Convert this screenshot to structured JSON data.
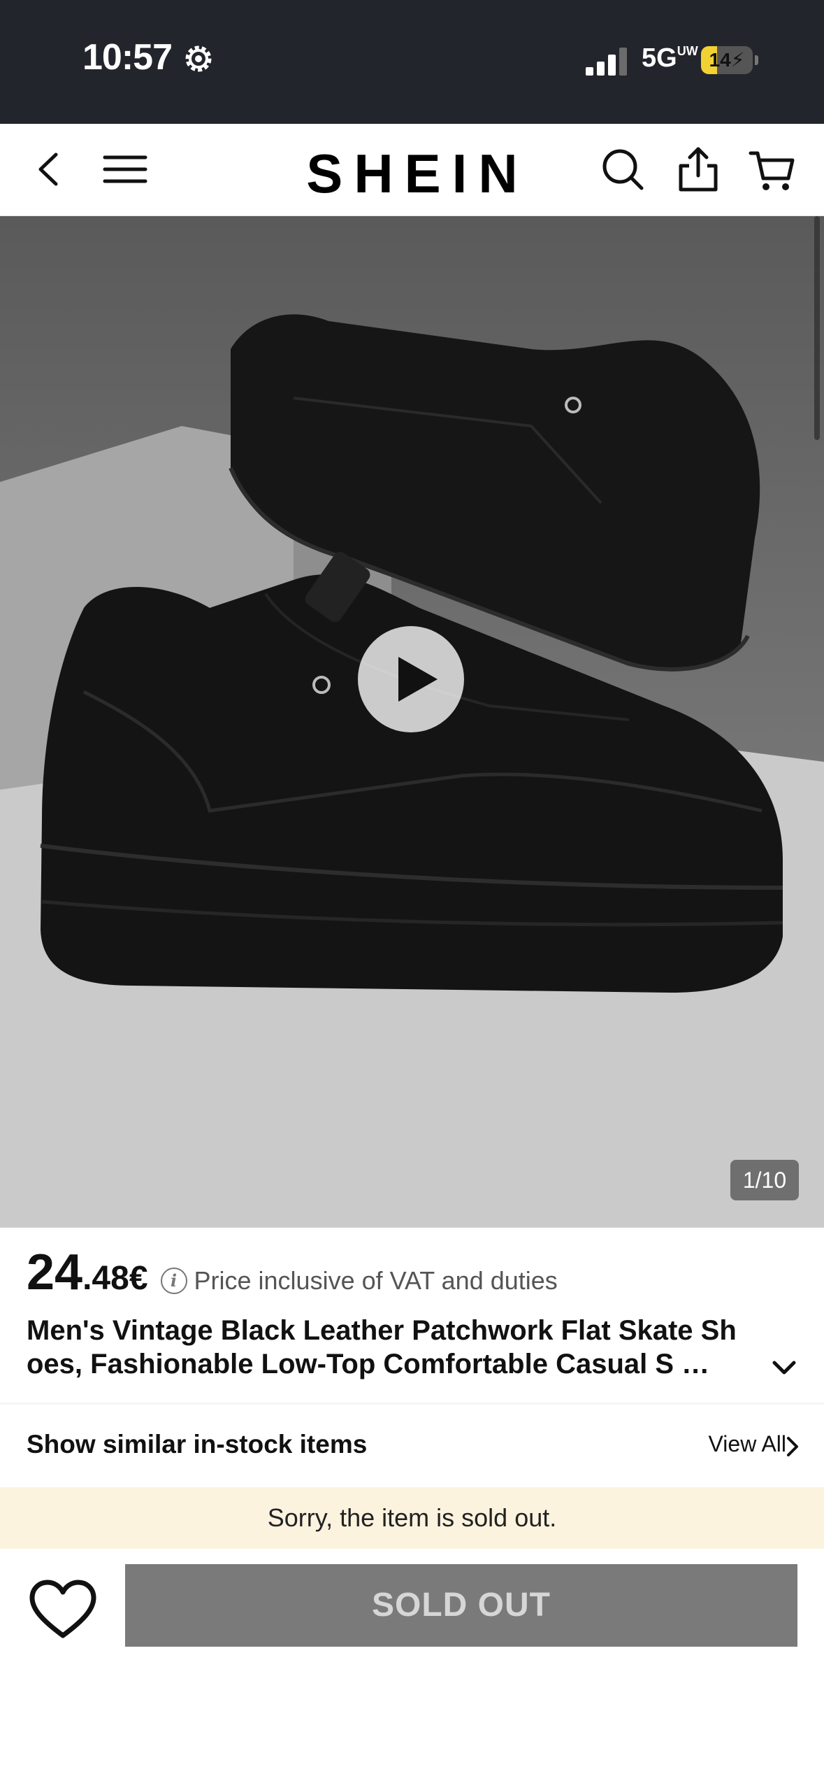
{
  "status_bar": {
    "time": "10:57",
    "network": "5G",
    "network_sup": "UW",
    "battery_percent": 14,
    "battery_label": "14",
    "icons": [
      "gear-icon",
      "signal-icon",
      "battery-icon"
    ]
  },
  "nav": {
    "brand": "SHEIN",
    "icons": [
      "back-arrow-icon",
      "menu-icon",
      "search-icon",
      "share-icon",
      "cart-icon"
    ]
  },
  "gallery": {
    "counter": "1/10",
    "has_video": true
  },
  "product": {
    "price_int": "24",
    "price_dec": ".48€",
    "price_note": "Price inclusive of VAT and duties",
    "title_line1": "Men's Vintage Black Leather Patchwork Flat Skate Sh",
    "title_line2": "oes, Fashionable Low-Top Comfortable Casual S …"
  },
  "similar": {
    "title": "Show similar in-stock items",
    "view_all": "View All"
  },
  "banner": {
    "soldout_text": "Sorry, the item is sold out."
  },
  "actions": {
    "soldout_label": "SOLD OUT"
  },
  "colors": {
    "status_bar_bg": "#23252c",
    "banner_bg": "#fcf3df",
    "soldout_button_bg": "#7a7a7a",
    "battery_fill": "#f2d233"
  }
}
